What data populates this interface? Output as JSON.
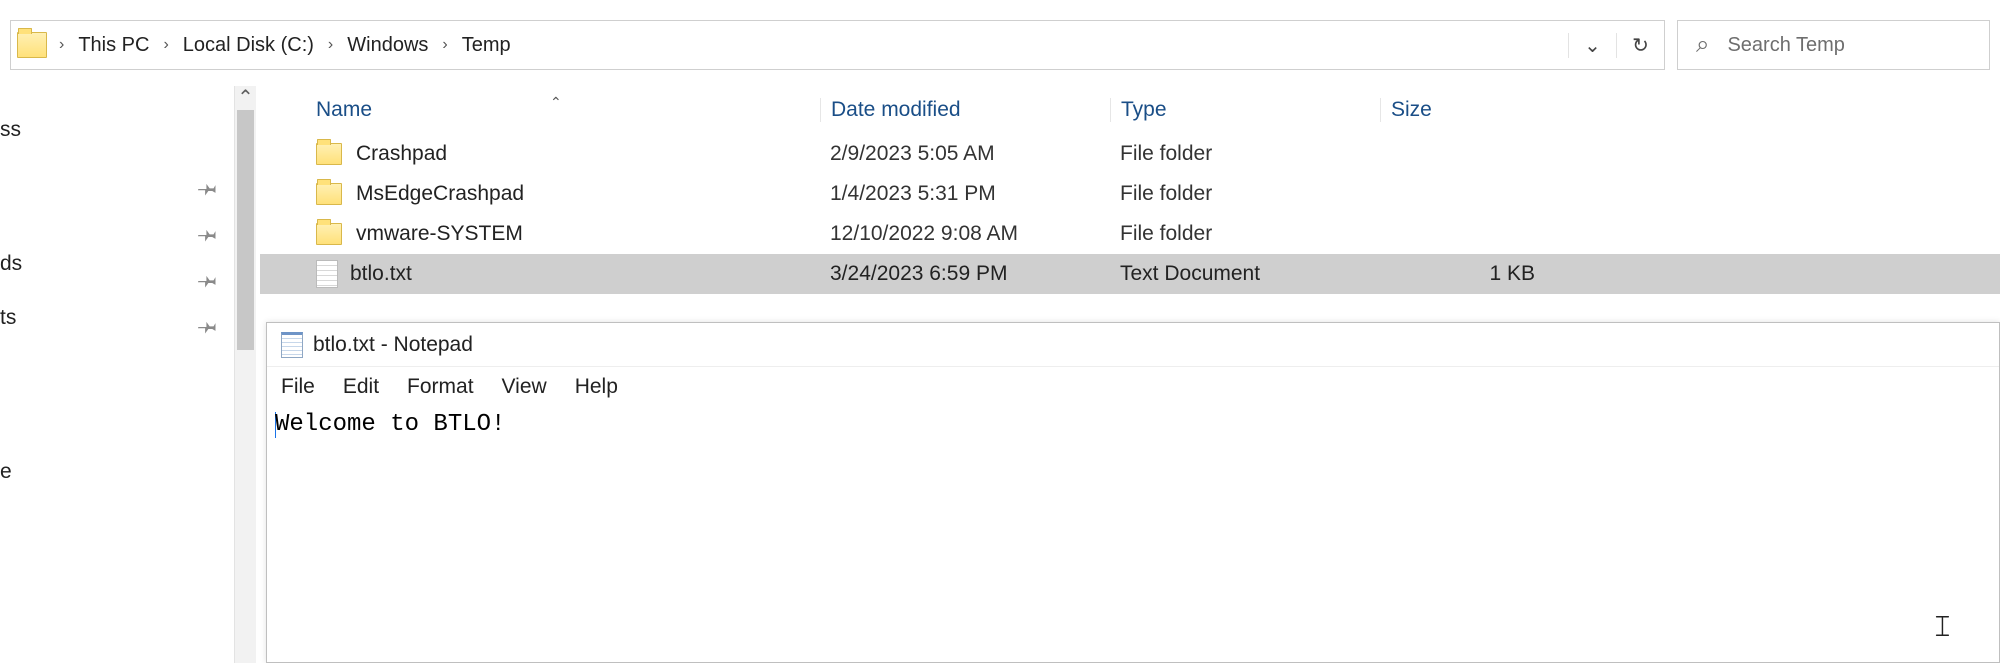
{
  "breadcrumb": {
    "items": [
      "This PC",
      "Local Disk (C:)",
      "Windows",
      "Temp"
    ],
    "sep": "›"
  },
  "addr_controls": {
    "history_glyph": "⌄",
    "refresh_glyph": "↻"
  },
  "search": {
    "placeholder": "Search Temp",
    "icon_glyph": "⌕"
  },
  "nav": {
    "items": [
      "ss",
      "ds",
      "ts",
      "e"
    ]
  },
  "columns": {
    "name": "Name",
    "date": "Date modified",
    "type": "Type",
    "size": "Size",
    "sort_glyph": "⌃"
  },
  "rows": [
    {
      "name": "Crashpad",
      "date": "2/9/2023 5:05 AM",
      "type": "File folder",
      "size": "",
      "kind": "folder",
      "selected": false
    },
    {
      "name": "MsEdgeCrashpad",
      "date": "1/4/2023 5:31 PM",
      "type": "File folder",
      "size": "",
      "kind": "folder",
      "selected": false
    },
    {
      "name": "vmware-SYSTEM",
      "date": "12/10/2022 9:08 AM",
      "type": "File folder",
      "size": "",
      "kind": "folder",
      "selected": false
    },
    {
      "name": "btlo.txt",
      "date": "3/24/2023 6:59 PM",
      "type": "Text Document",
      "size": "1 KB",
      "kind": "file",
      "selected": true
    }
  ],
  "notepad": {
    "title": "btlo.txt - Notepad",
    "menu": [
      "File",
      "Edit",
      "Format",
      "View",
      "Help"
    ],
    "content": "Welcome to BTLO!"
  },
  "scrollbar": {
    "up_glyph": "⌃"
  },
  "ibeam_glyph": "𝙸"
}
